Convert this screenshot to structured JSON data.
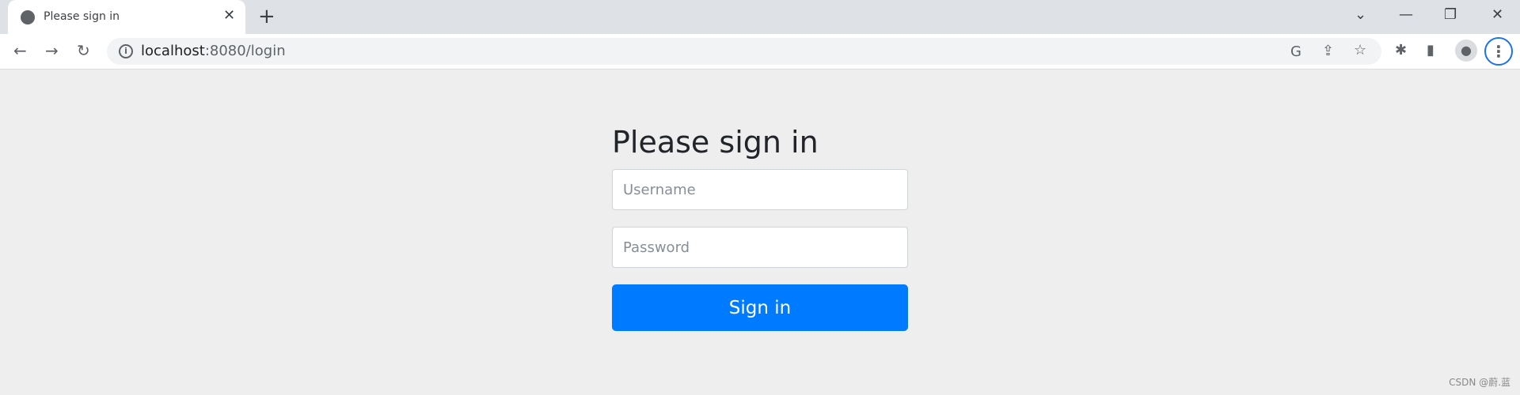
{
  "browser": {
    "tab_title": "Please sign in",
    "url_host": "localhost",
    "url_rest": ":8080/login",
    "accent": "#1a73e8"
  },
  "form": {
    "heading": "Please sign in",
    "username_placeholder": "Username",
    "password_placeholder": "Password",
    "submit_label": "Sign in",
    "button_color": "#007bff"
  },
  "watermark": "CSDN @蔚.蓝"
}
